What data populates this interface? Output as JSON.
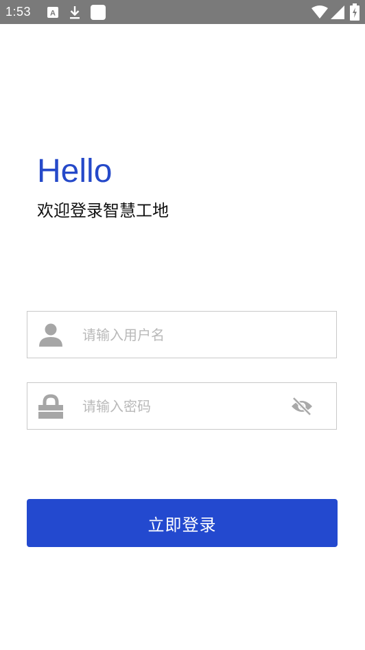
{
  "status_bar": {
    "time": "1:53",
    "bg_color": "#7a7a7a",
    "icons": [
      "a-box-icon",
      "download-icon",
      "square-icon",
      "wifi-icon",
      "signal-icon",
      "battery-icon"
    ]
  },
  "header": {
    "greeting": "Hello",
    "subtitle": "欢迎登录智慧工地",
    "accent_color": "#2549c9"
  },
  "form": {
    "username": {
      "placeholder": "请输入用户名",
      "value": "",
      "icon": "user-icon"
    },
    "password": {
      "placeholder": "请输入密码",
      "value": "",
      "icon": "lock-icon",
      "toggle_icon": "eye-off-icon"
    },
    "submit_label": "立即登录",
    "button_color": "#2349cf"
  }
}
